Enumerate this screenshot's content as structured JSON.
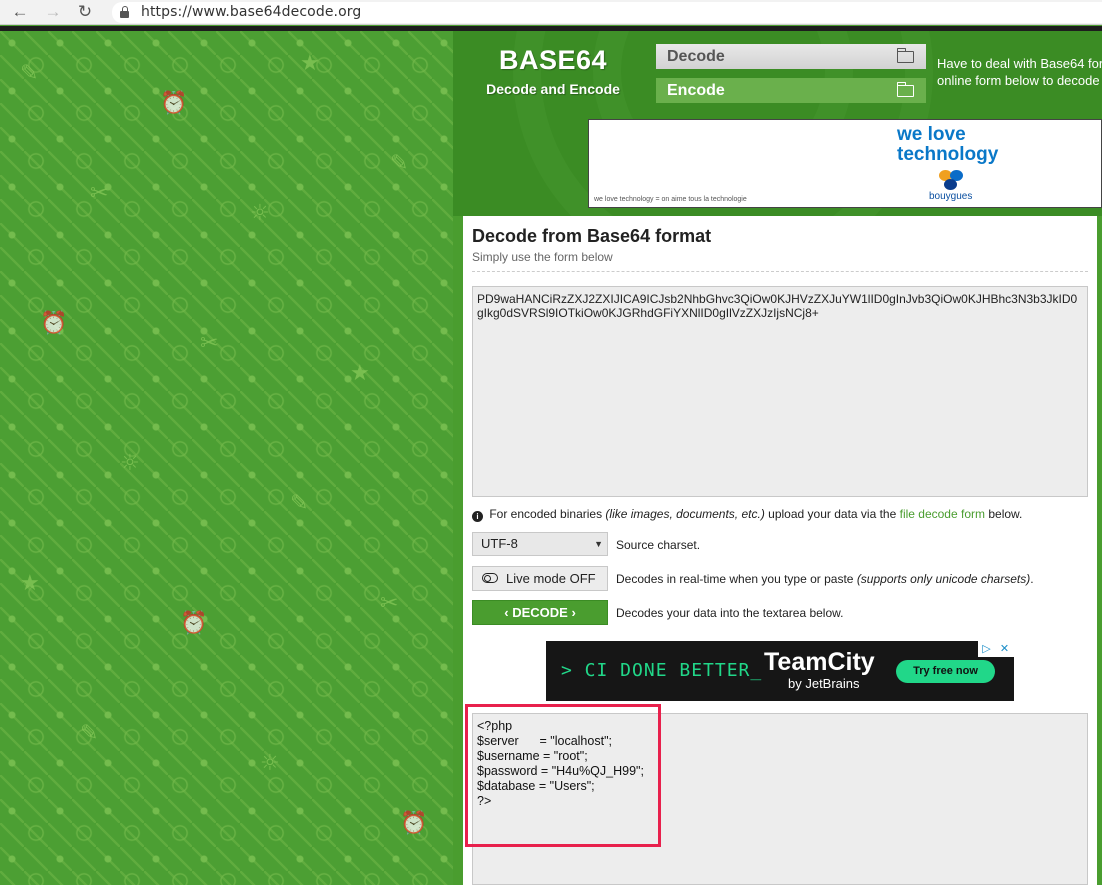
{
  "browser": {
    "url": "https://www.base64decode.org"
  },
  "header": {
    "brand_title": "BASE64",
    "brand_subtitle": "Decode and Encode",
    "nav": {
      "decode_label": "Decode",
      "encode_label": "Encode"
    },
    "intro_line1": "Have to deal with Base64 for",
    "intro_line2": "online form below to decode"
  },
  "ad_top": {
    "line1": "we love",
    "line2": "technology",
    "brand": "bouygues",
    "small_text": "we love technology = on aime tous la technologie"
  },
  "form": {
    "title": "Decode from Base64 format",
    "subtitle": "Simply use the form below",
    "input_text": "PD9waHANCiRzZXJ2ZXIJICA9ICJsb2NhbGhvc3QiOw0KJHVzZXJuYW1lID0gInJvb3QiOw0KJHBhc3N3b3JkID0gIkg0dSVRSl9IOTkiOw0KJGRhdGFiYXNlID0gIlVzZXJzIjsNCj8+",
    "info_prefix": "For encoded binaries",
    "info_italic": "(like images, documents, etc.)",
    "info_middle": "upload your data via the",
    "info_link": "file decode form",
    "info_suffix": "below.",
    "charset_value": "UTF-8",
    "charset_label": "Source charset.",
    "live_mode_label": "Live mode OFF",
    "live_desc": "Decodes in real-time when you type or paste",
    "live_desc_italic": "(supports only unicode charsets)",
    "decode_button": "DECODE",
    "decode_desc": "Decodes your data into the textarea below."
  },
  "ad_teamcity": {
    "tagline": "> CI DONE BETTER_",
    "product": "TeamCity",
    "byline": "by JetBrains",
    "cta": "Try free now"
  },
  "output": {
    "lines": [
      "<?php",
      "$server      = \"localhost\";",
      "$username = \"root\";",
      "$password = \"H4u%QJ_H99\";",
      "$database = \"Users\";",
      "?>"
    ]
  },
  "colors": {
    "brand_green": "#4a9d2f",
    "highlight_red": "#e8204c",
    "teamcity_green": "#21d789"
  }
}
